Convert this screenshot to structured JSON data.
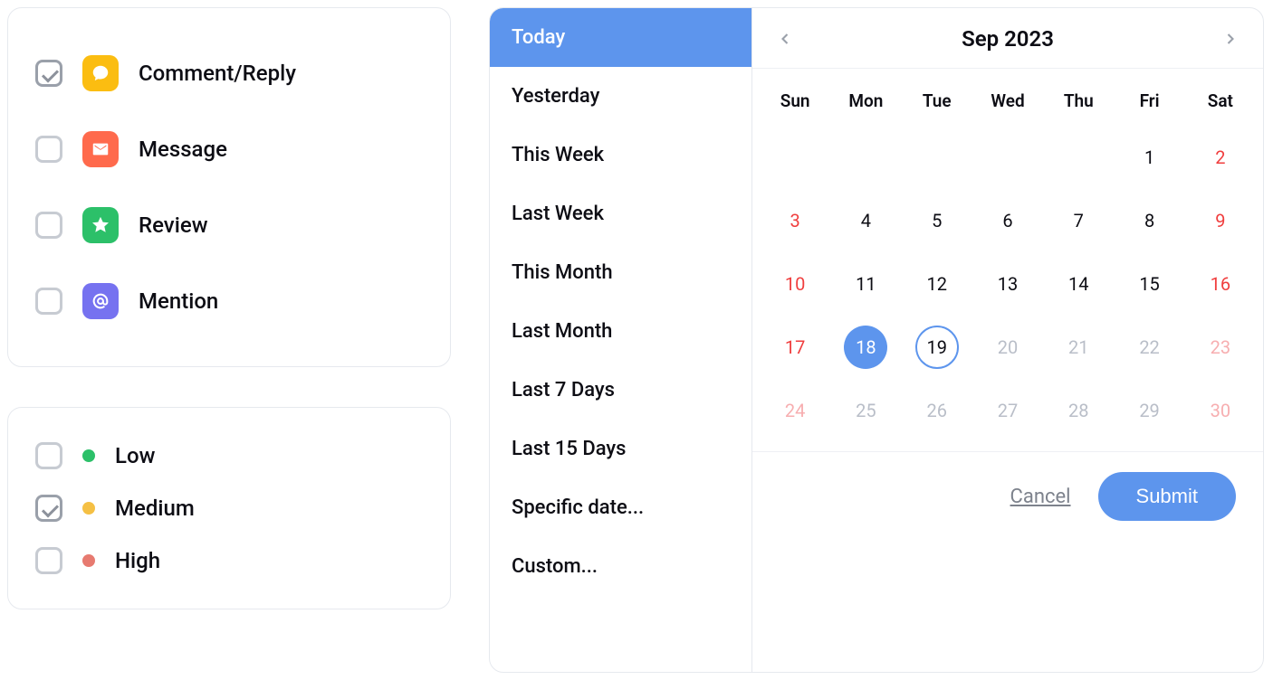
{
  "types": {
    "items": [
      {
        "label": "Comment/Reply",
        "checked": true,
        "color": "#FBBD11",
        "icon": "chat"
      },
      {
        "label": "Message",
        "checked": false,
        "color": "#FF6A4C",
        "icon": "mail"
      },
      {
        "label": "Review",
        "checked": false,
        "color": "#2CC069",
        "icon": "star"
      },
      {
        "label": "Mention",
        "checked": false,
        "color": "#7672F0",
        "icon": "at"
      }
    ]
  },
  "priority": {
    "items": [
      {
        "label": "Low",
        "checked": false,
        "color": "#2CC069"
      },
      {
        "label": "Medium",
        "checked": true,
        "color": "#F5C044"
      },
      {
        "label": "High",
        "checked": false,
        "color": "#E77A70"
      }
    ]
  },
  "presets": {
    "items": [
      "Today",
      "Yesterday",
      "This Week",
      "Last Week",
      "This Month",
      "Last Month",
      "Last 7 Days",
      "Last 15 Days",
      "Specific date...",
      "Custom..."
    ],
    "selected_index": 0
  },
  "calendar": {
    "title": "Sep 2023",
    "days_of_week": [
      "Sun",
      "Mon",
      "Tue",
      "Wed",
      "Thu",
      "Fri",
      "Sat"
    ],
    "weeks": [
      [
        {
          "n": "",
          "w": false,
          "d": true
        },
        {
          "n": "",
          "w": false,
          "d": true
        },
        {
          "n": "",
          "w": false,
          "d": true
        },
        {
          "n": "",
          "w": false,
          "d": true
        },
        {
          "n": "",
          "w": false,
          "d": true
        },
        {
          "n": "1",
          "w": false,
          "d": false
        },
        {
          "n": "2",
          "w": true,
          "d": false
        }
      ],
      [
        {
          "n": "3",
          "w": true,
          "d": false
        },
        {
          "n": "4",
          "w": false,
          "d": false
        },
        {
          "n": "5",
          "w": false,
          "d": false
        },
        {
          "n": "6",
          "w": false,
          "d": false
        },
        {
          "n": "7",
          "w": false,
          "d": false
        },
        {
          "n": "8",
          "w": false,
          "d": false
        },
        {
          "n": "9",
          "w": true,
          "d": false
        }
      ],
      [
        {
          "n": "10",
          "w": true,
          "d": false
        },
        {
          "n": "11",
          "w": false,
          "d": false
        },
        {
          "n": "12",
          "w": false,
          "d": false
        },
        {
          "n": "13",
          "w": false,
          "d": false
        },
        {
          "n": "14",
          "w": false,
          "d": false
        },
        {
          "n": "15",
          "w": false,
          "d": false
        },
        {
          "n": "16",
          "w": true,
          "d": false
        }
      ],
      [
        {
          "n": "17",
          "w": true,
          "d": false
        },
        {
          "n": "18",
          "w": false,
          "d": false,
          "sel": true
        },
        {
          "n": "19",
          "w": false,
          "d": false,
          "today": true
        },
        {
          "n": "20",
          "w": false,
          "d": true
        },
        {
          "n": "21",
          "w": false,
          "d": true
        },
        {
          "n": "22",
          "w": false,
          "d": true
        },
        {
          "n": "23",
          "w": true,
          "d": true
        }
      ],
      [
        {
          "n": "24",
          "w": true,
          "d": true
        },
        {
          "n": "25",
          "w": false,
          "d": true
        },
        {
          "n": "26",
          "w": false,
          "d": true
        },
        {
          "n": "27",
          "w": false,
          "d": true
        },
        {
          "n": "28",
          "w": false,
          "d": true
        },
        {
          "n": "29",
          "w": false,
          "d": true
        },
        {
          "n": "30",
          "w": true,
          "d": true
        }
      ]
    ]
  },
  "buttons": {
    "cancel": "Cancel",
    "submit": "Submit"
  }
}
